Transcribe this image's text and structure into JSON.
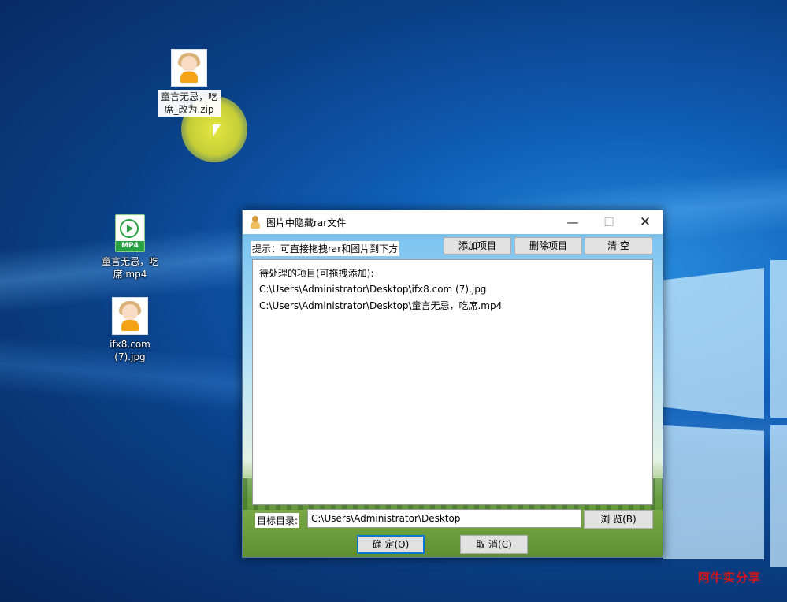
{
  "desktop": {
    "icons": [
      {
        "label_line1": "童言无忌，吃",
        "label_line2": "席_改为.zip",
        "type": "zip-image"
      },
      {
        "label_line1": "童言无忌，吃",
        "label_line2": "席.mp4",
        "type": "mp4",
        "tag": "MP4"
      },
      {
        "label_line1": "ifx8.com",
        "label_line2": "(7).jpg",
        "type": "jpg"
      }
    ]
  },
  "window": {
    "title": "图片中隐藏rar文件",
    "hint": "提示：可直接拖拽rar和图片到下方",
    "buttons": {
      "add": "添加项目",
      "delete": "删除项目",
      "clear": "清 空",
      "browse": "浏 览(B)",
      "ok": "确 定(O)",
      "cancel": "取 消(C)"
    },
    "list": {
      "header": "待处理的项目(可拖拽添加):",
      "items": [
        "C:\\Users\\Administrator\\Desktop\\ifx8.com (7).jpg",
        "C:\\Users\\Administrator\\Desktop\\童言无忌，吃席.mp4"
      ]
    },
    "dest_label": "目标目录:",
    "dest_value": "C:\\Users\\Administrator\\Desktop"
  },
  "watermark": "阿牛实分享"
}
